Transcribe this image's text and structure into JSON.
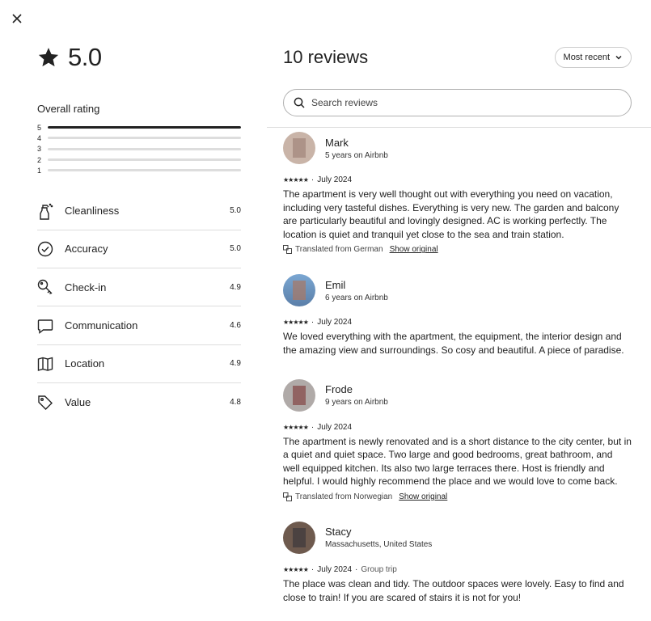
{
  "summary": {
    "rating": "5.0"
  },
  "overall": {
    "title": "Overall rating",
    "bars": [
      {
        "label": "5",
        "fraction": 1.0
      },
      {
        "label": "4",
        "fraction": 0.0
      },
      {
        "label": "3",
        "fraction": 0.0
      },
      {
        "label": "2",
        "fraction": 0.0
      },
      {
        "label": "1",
        "fraction": 0.0
      }
    ]
  },
  "categories": [
    {
      "label": "Cleanliness",
      "value": "5.0",
      "icon": "spray-bottle-icon"
    },
    {
      "label": "Accuracy",
      "value": "5.0",
      "icon": "check-circle-icon"
    },
    {
      "label": "Check-in",
      "value": "4.9",
      "icon": "key-icon"
    },
    {
      "label": "Communication",
      "value": "4.6",
      "icon": "message-icon"
    },
    {
      "label": "Location",
      "value": "4.9",
      "icon": "map-icon"
    },
    {
      "label": "Value",
      "value": "4.8",
      "icon": "tag-icon"
    }
  ],
  "header": {
    "count": "10 reviews",
    "sort_label": "Most recent"
  },
  "search": {
    "placeholder": "Search reviews"
  },
  "reviews": [
    {
      "name": "Mark",
      "since": "5 years on Airbnb",
      "stars": "★★★★★",
      "date": "July 2024",
      "extra": "",
      "text": "The apartment is very well thought out with everything you need on vacation, including very tasteful dishes. Everything is very new. The garden and balcony are particularly beautiful and lovingly designed. AC is working perfectly. The location is quiet and tranquil yet close to the sea and train station.",
      "translated": "Translated from German",
      "show_original": "Show original"
    },
    {
      "name": "Emil",
      "since": "6 years on Airbnb",
      "stars": "★★★★★",
      "date": "July 2024",
      "extra": "",
      "text": "We loved everything with the apartment, the equipment, the interior design and the amazing view and surroundings. So cosy and beautiful. A piece of paradise.",
      "translated": "",
      "show_original": ""
    },
    {
      "name": "Frode",
      "since": "9 years on Airbnb",
      "stars": "★★★★★",
      "date": "July 2024",
      "extra": "",
      "text": "The apartment is newly renovated and is a short distance to the city center, but in a quiet and quiet space. Two large and good bedrooms, great bathroom, and well equipped kitchen. Its also two large terraces there. Host is friendly and helpful. I would highly recommend the place and we would love to come back.",
      "translated": "Translated from Norwegian",
      "show_original": "Show original"
    },
    {
      "name": "Stacy",
      "since": "Massachusetts, United States",
      "stars": "★★★★★",
      "date": "July 2024",
      "extra": "Group trip",
      "text": "The place was clean and tidy. The outdoor spaces were lovely. Easy to find and close to train! If you are scared of stairs it is not for you!",
      "translated": "",
      "show_original": ""
    }
  ]
}
